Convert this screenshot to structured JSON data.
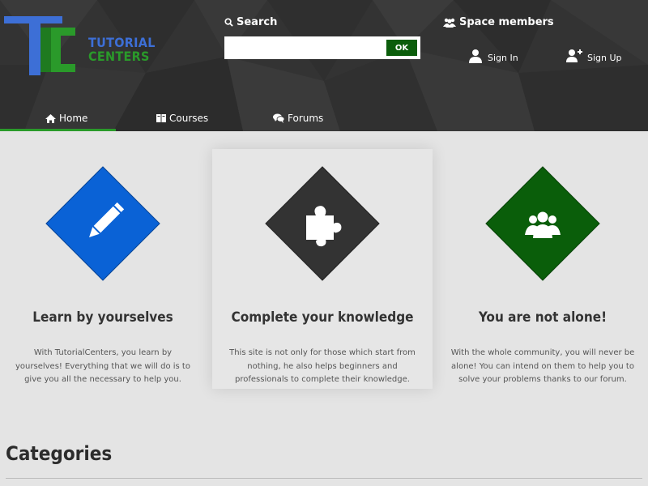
{
  "logo": {
    "line1": "TUTORIAL",
    "line2": "CENTERS"
  },
  "search": {
    "label": "Search",
    "placeholder": "",
    "value": "",
    "button_label": "OK"
  },
  "members": {
    "label": "Space members",
    "sign_in": "Sign In",
    "sign_up": "Sign Up"
  },
  "nav": {
    "items": [
      {
        "label": "Home",
        "icon": "home-icon",
        "active": true
      },
      {
        "label": "Courses",
        "icon": "book-icon"
      },
      {
        "label": "Forums",
        "icon": "comments-icon"
      }
    ]
  },
  "features": [
    {
      "title": "Learn by yourselves",
      "text": "With TutorialCenters, you learn by yourselves! Everything that we will do is to give you all the necessary to help you.",
      "color": "#0a62d6",
      "icon": "pencil-icon"
    },
    {
      "title": "Complete your knowledge",
      "text": "This site is not only for those which start from nothing, he also helps beginners and professionals to complete their knowledge.",
      "color": "#333333",
      "icon": "puzzle-icon"
    },
    {
      "title": "You are not alone!",
      "text": "With the whole community, you will never be alone! You can intend on them to help you to solve your problems thanks to our forum.",
      "color": "#0a5e0a",
      "icon": "group-icon"
    }
  ],
  "categories": {
    "title": "Categories"
  },
  "colors": {
    "header_bg": "#333333",
    "accent_green": "#2a9a2a",
    "accent_blue": "#3d6fd6",
    "ok_button": "#0b5d0b"
  }
}
